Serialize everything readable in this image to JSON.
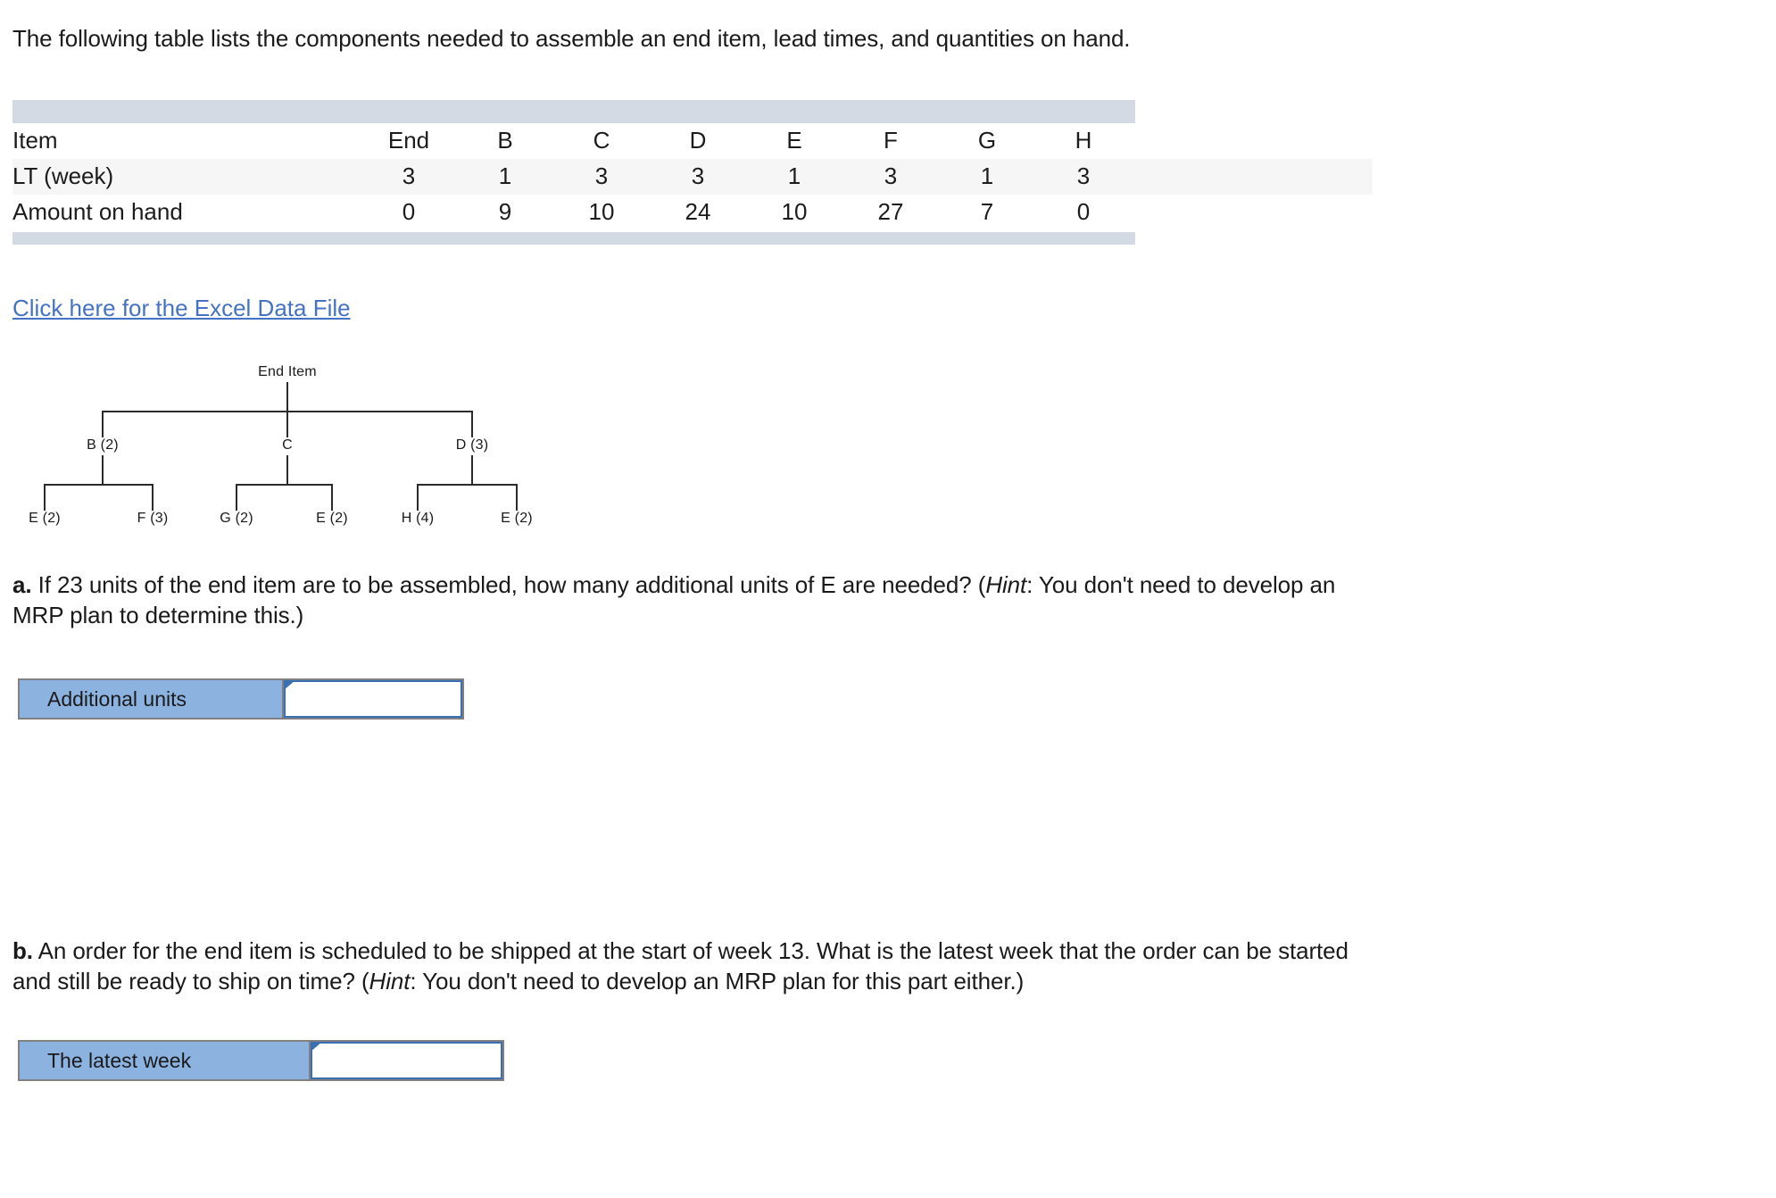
{
  "intro": "The following table lists the components needed to assemble an end item, lead times, and quantities on hand.",
  "table": {
    "row_labels": [
      "Item",
      "LT (week)",
      "Amount on hand"
    ],
    "columns": [
      "End",
      "B",
      "C",
      "D",
      "E",
      "F",
      "G",
      "H"
    ],
    "lead_time_weeks": [
      "3",
      "1",
      "3",
      "3",
      "1",
      "3",
      "1",
      "3"
    ],
    "amount_on_hand": [
      "0",
      "9",
      "10",
      "24",
      "10",
      "27",
      "7",
      "0"
    ]
  },
  "excel_link": "Click here for the Excel Data File",
  "tree": {
    "root": "End Item",
    "level1": [
      "B (2)",
      "C",
      "D (3)"
    ],
    "level2": [
      "E (2)",
      "F (3)",
      "G (2)",
      "E (2)",
      "H (4)",
      "E (2)"
    ]
  },
  "question_a": {
    "marker": "a.",
    "line1_part1": " If 23 units of the end item are to be assembled, how many additional units of E are needed? (",
    "hint_word": "Hint",
    "line1_part2": ": You don't need to develop an",
    "line2": "MRP plan to determine this.)",
    "answer_label": "Additional units",
    "answer_value": "",
    "answer_placeholder": ""
  },
  "question_b": {
    "marker": "b.",
    "line1_part1": " An order for the end item is scheduled to be shipped at the start of week 13. What is the latest week that the order can be started",
    "line2_part1": "and still be ready to ship on time? (",
    "hint_word": "Hint",
    "line2_part2": ": You don't need to develop an MRP plan for this part either.)",
    "answer_label": "The latest week",
    "answer_value": "",
    "answer_placeholder": ""
  },
  "colors": {
    "link": "#4472c4",
    "table_band": "#d4dae4",
    "answer_label_fill": "#8cb3e0",
    "answer_marker": "#3a6fb5"
  }
}
